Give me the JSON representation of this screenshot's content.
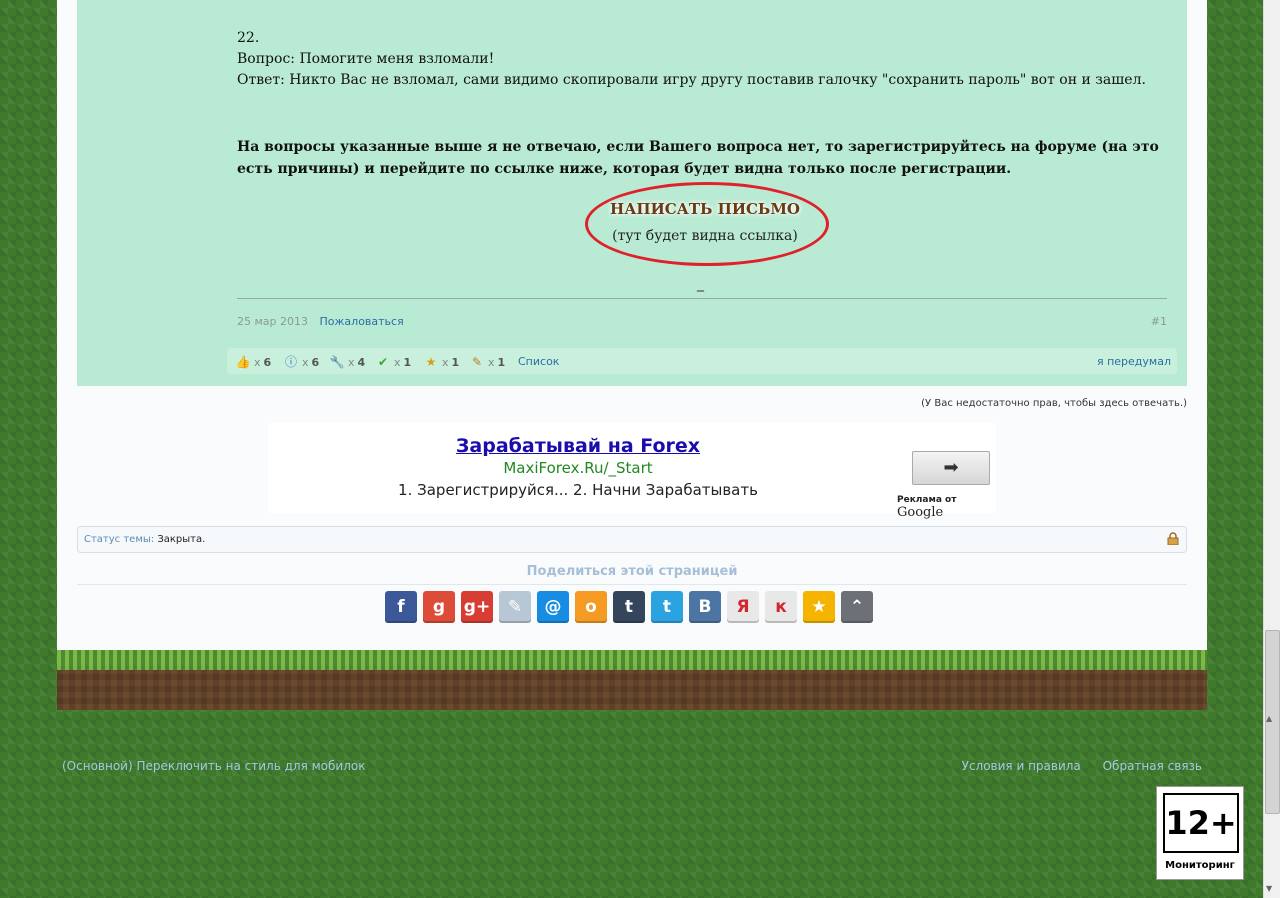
{
  "post": {
    "number": "22.",
    "question": "Вопрос: Помогите меня взломали!",
    "answer": "Ответ: Никто Вас не взломал, сами видимо скопировали игру другу поставив галочку \"сохранить пароль\" вот он и зашел.",
    "notice": "На вопросы указанные выше я не отвечаю, если Вашего вопроса нет, то зарегистрируйтесь на форуме (на это есть причины) и перейдите по ссылке ниже, которая будет видна только после регистрации.",
    "write_button": "НАПИСАТЬ ПИСЬМО",
    "write_sub": "(тут будет видна ссылка)",
    "dash": "_",
    "date": "25 мар 2013",
    "report": "Пожаловаться",
    "post_num": "#1"
  },
  "likes": {
    "items": [
      {
        "icon": "thumbs-up-icon",
        "count": "6"
      },
      {
        "icon": "info-icon",
        "count": "6"
      },
      {
        "icon": "wrench-icon",
        "count": "4"
      },
      {
        "icon": "checkmark-icon",
        "count": "1"
      },
      {
        "icon": "star-badge-icon",
        "count": "1"
      },
      {
        "icon": "pencil-icon",
        "count": "1"
      }
    ],
    "list_label": "Список",
    "changed_label": "я передумал"
  },
  "norights": "(У Вас недостаточно прав, чтобы здесь отвечать.)",
  "ad": {
    "title": "Зарабатывай на Forex",
    "url": "MaxiForex.Ru/_Start",
    "text": "1. Зарегистрируйся... 2. Начни Зарабатывать",
    "by": "Реклама от",
    "google": "Google"
  },
  "status": {
    "label": "Статус темы:",
    "value": "Закрыта."
  },
  "share": {
    "title": "Поделиться этой страницей",
    "buttons": [
      {
        "name": "facebook",
        "glyph": "f",
        "color": "#3b5998"
      },
      {
        "name": "google",
        "glyph": "g",
        "color": "#dd4b39"
      },
      {
        "name": "google-plus",
        "glyph": "g+",
        "color": "#d73d32"
      },
      {
        "name": "livejournal",
        "glyph": "✎",
        "color": "#b8c7d6"
      },
      {
        "name": "mail-ru",
        "glyph": "@",
        "color": "#168de2"
      },
      {
        "name": "odnoklassniki",
        "glyph": "о",
        "color": "#f59a23"
      },
      {
        "name": "tumblr",
        "glyph": "t",
        "color": "#35465c"
      },
      {
        "name": "twitter",
        "glyph": "t",
        "color": "#2ba3e1"
      },
      {
        "name": "vkontakte",
        "glyph": "В",
        "color": "#4c75a3"
      },
      {
        "name": "yandex",
        "glyph": "Я",
        "color": "#e8e8e8"
      },
      {
        "name": "moi-krug",
        "glyph": "к",
        "color": "#e8e8e8"
      },
      {
        "name": "bookmark",
        "glyph": "★",
        "color": "#f4b400"
      },
      {
        "name": "more",
        "glyph": "⌃",
        "color": "#6d7177"
      }
    ]
  },
  "footer": {
    "left": "(Основной) Переключить на стиль для мобилок",
    "terms": "Условия и правила",
    "feedback": "Обратная связь"
  },
  "age_badge": {
    "rating": "12+",
    "label": "Мониторинг"
  }
}
